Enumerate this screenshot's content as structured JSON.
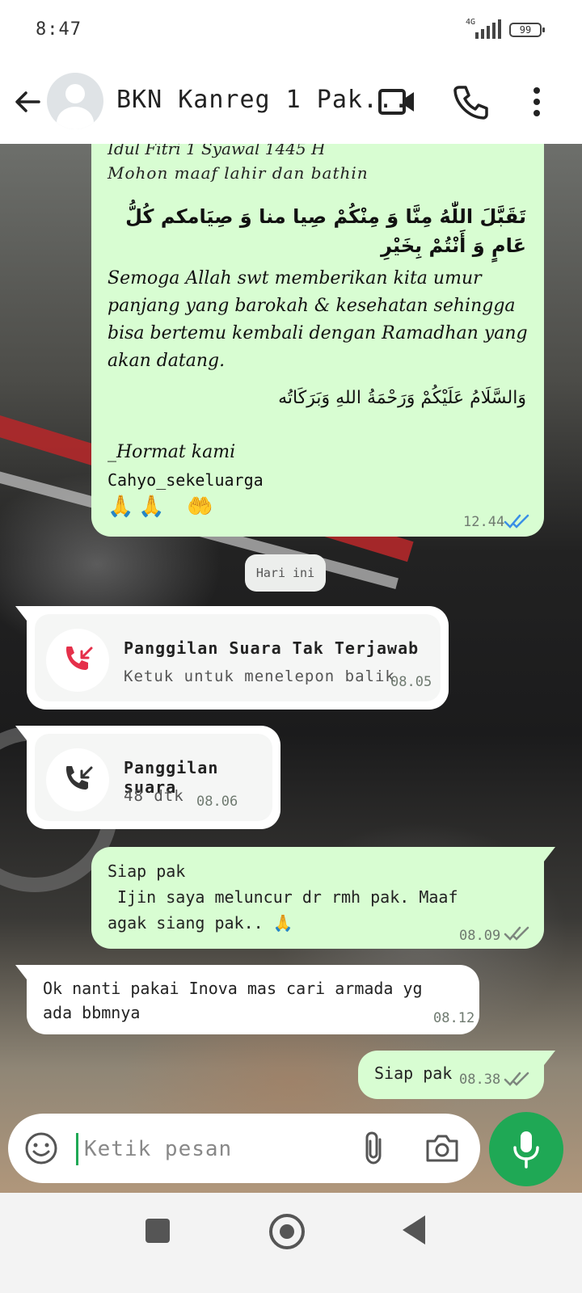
{
  "status_bar": {
    "time": "8:47",
    "network": "4G",
    "battery": "99"
  },
  "header": {
    "title": "BKN Kanreg 1 Pak..."
  },
  "messages": {
    "m1": {
      "line1": "Idul Fitri 1 Syawal 1445 H",
      "line2": "Mohon maaf lahir dan bathin",
      "arabic1": "تَقَبَّلَ اللّٰهُ مِنَّا وَ مِنْكُمْ صِيا منا وَ صِيَامكم كُلُّ عَامٍ وَ أَنْتُمْ بِخَيْرِ",
      "paragraph": "Semoga Allah swt memberikan kita umur panjang yang barokah & kesehatan sehingga bisa bertemu kembali dengan Ramadhan yang akan datang.",
      "arabic2": "وَالسَّلَامُ عَلَيْكُمْ وَرَحْمَةُ اللهِ وَبَرَكَاتُه",
      "signoff": "_Hormat   kami",
      "sender": "Cahyo_sekeluarga",
      "emojis": "🙏🙏 🤲",
      "time": "12.44"
    },
    "day_separator": "Hari ini",
    "m2": {
      "title": "Panggilan Suara Tak Terjawab",
      "subtitle": "Ketuk untuk menelepon balik",
      "time": "08.05"
    },
    "m3": {
      "title": "Panggilan suara",
      "subtitle": "48 dtk",
      "time": "08.06"
    },
    "m4": {
      "text": "Siap pak\n Ijin saya meluncur dr rmh pak. Maaf agak siang pak.. 🙏",
      "time": "08.09"
    },
    "m5": {
      "text": "Ok nanti pakai Inova mas cari armada yg ada bbmnya",
      "time": "08.12"
    },
    "m6": {
      "text": "Siap pak",
      "time": "08.38"
    }
  },
  "composer": {
    "placeholder": "Ketik pesan"
  },
  "icons": {
    "back": "arrow-left-icon",
    "video": "video-call-icon",
    "call": "phone-icon",
    "menu": "more-vert-icon",
    "missed_call": "missed-call-icon",
    "incoming_call": "incoming-call-icon",
    "emoji": "emoji-icon",
    "attach": "paperclip-icon",
    "camera": "camera-icon",
    "mic": "mic-icon"
  },
  "colors": {
    "accent": "#1fa855",
    "outgoing_bubble": "#d8fdd2",
    "read_ticks": "#3a8fe6",
    "missed_call": "#e5304a"
  }
}
